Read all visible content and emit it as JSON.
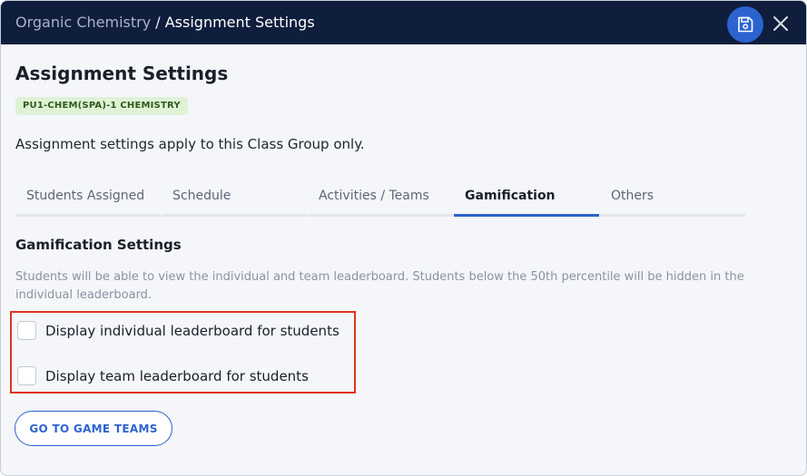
{
  "header": {
    "breadcrumb_parent": "Organic Chemistry",
    "breadcrumb_separator": " / ",
    "breadcrumb_current": "Assignment Settings",
    "background_color": "#0f1e3d",
    "save_icon": "save-icon",
    "close_icon": "close-icon"
  },
  "page": {
    "title": "Assignment Settings",
    "badge": "PU1-CHEM(SPA)-1 CHEMISTRY",
    "description": "Assignment settings apply to this Class Group only."
  },
  "tabs": [
    {
      "label": "Students Assigned",
      "active": false
    },
    {
      "label": "Schedule",
      "active": false
    },
    {
      "label": "Activities / Teams",
      "active": false
    },
    {
      "label": "Gamification",
      "active": true
    },
    {
      "label": "Others",
      "active": false
    }
  ],
  "gamification": {
    "section_title": "Gamification Settings",
    "help_text": "Students will be able to view the individual and team leaderboard. Students below the 50th percentile will be hidden in the individual leaderboard.",
    "options": [
      {
        "label": "Display individual leaderboard for students",
        "checked": false
      },
      {
        "label": "Display team leaderboard for students",
        "checked": false
      }
    ],
    "game_teams_button": "GO TO GAME TEAMS"
  },
  "colors": {
    "accent": "#2b63cf",
    "highlight_border": "#e0331f",
    "badge_bg": "#dff2d6"
  }
}
